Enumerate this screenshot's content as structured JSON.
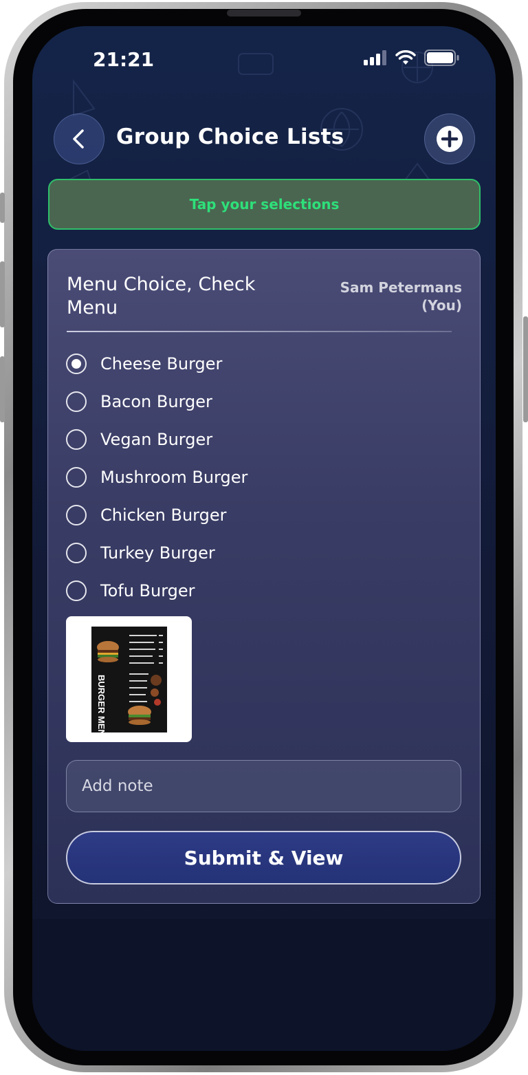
{
  "status_bar": {
    "time": "21:21",
    "icons": [
      "signal-icon",
      "wifi-icon",
      "battery-icon"
    ]
  },
  "header": {
    "title": "Group Choice Lists",
    "back_icon": "chevron-left-icon",
    "add_icon": "plus-circle-icon"
  },
  "banner": {
    "text": "Tap your selections",
    "color": "#2ee07a"
  },
  "card": {
    "title": "Menu Choice, Check Menu",
    "owner": "Sam Petermans (You)",
    "options": [
      {
        "label": "Cheese Burger",
        "selected": true
      },
      {
        "label": "Bacon Burger",
        "selected": false
      },
      {
        "label": "Vegan Burger",
        "selected": false
      },
      {
        "label": "Mushroom Burger",
        "selected": false
      },
      {
        "label": "Chicken Burger",
        "selected": false
      },
      {
        "label": "Turkey Burger",
        "selected": false
      },
      {
        "label": "Tofu Burger",
        "selected": false
      }
    ],
    "menu_image_text": "BURGER MENU",
    "note_placeholder": "Add note",
    "submit_label": "Submit & View"
  },
  "colors": {
    "background": "#142449",
    "banner_bg": "#4a6650",
    "submit_bg": "#2e3b86"
  }
}
